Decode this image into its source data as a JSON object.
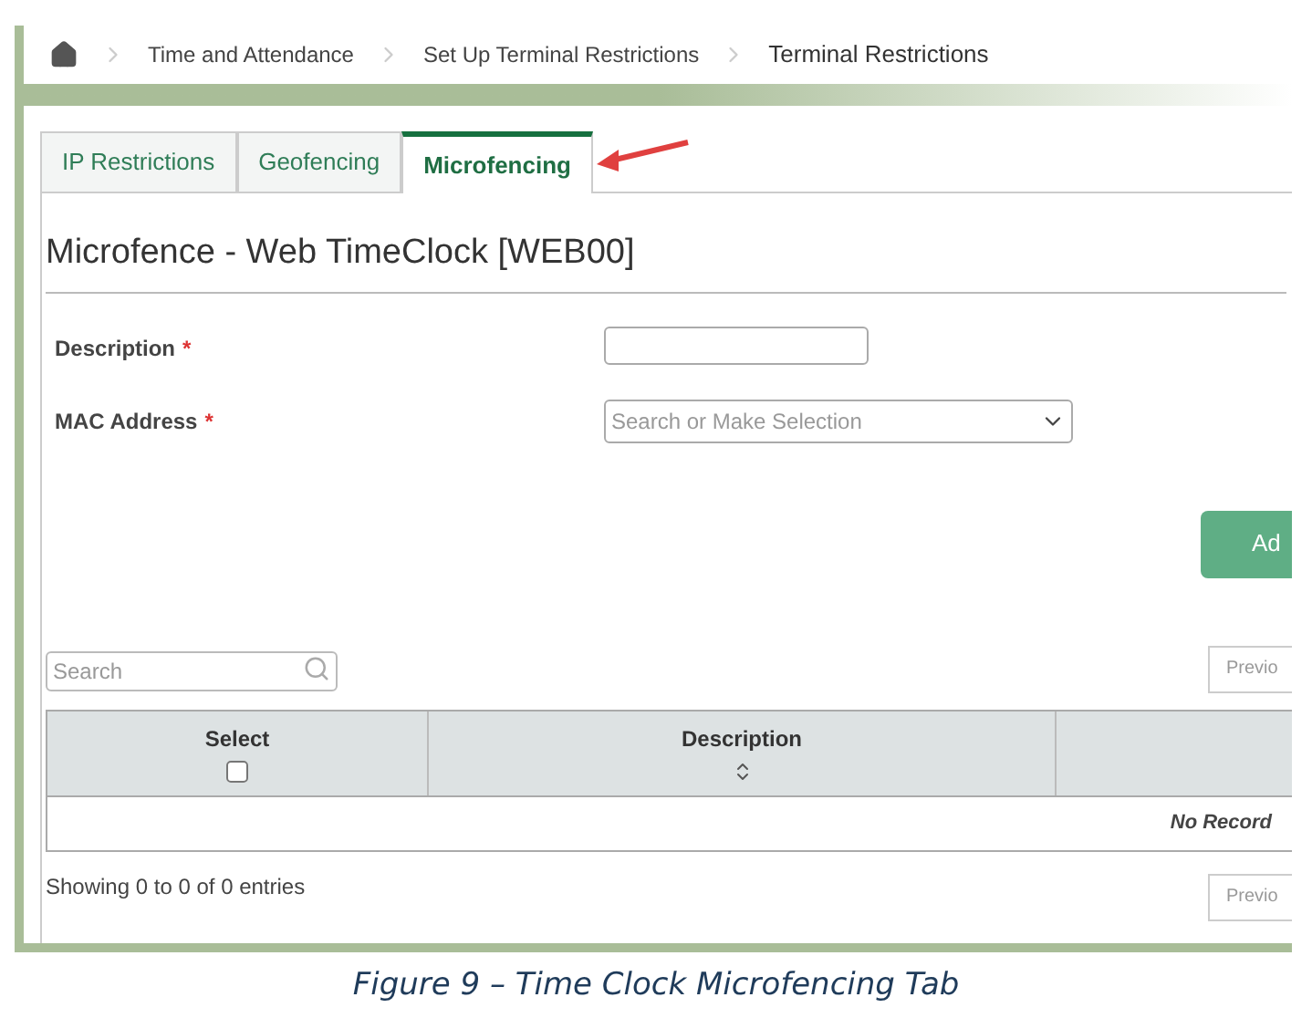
{
  "breadcrumb": [
    "Time and Attendance",
    "Set Up Terminal Restrictions",
    "Terminal Restrictions"
  ],
  "tabs": [
    {
      "label": "IP Restrictions",
      "selected": false
    },
    {
      "label": "Geofencing",
      "selected": false
    },
    {
      "label": "Microfencing",
      "selected": true
    }
  ],
  "title": "Microfence - Web TimeClock [WEB00]",
  "form": [
    {
      "kind": "text",
      "label": "Description",
      "marker": "*"
    },
    {
      "kind": "select",
      "label": "MAC Address",
      "marker": "*",
      "placeholder": "Search or Make Selection"
    }
  ],
  "add_button": "Ad",
  "search": {
    "placeholder": "Search"
  },
  "pager_top": "Previo",
  "table": {
    "columns": [
      {
        "label": "Select",
        "kind": "checkbox",
        "checked": false
      },
      {
        "label": "Description",
        "kind": "sort"
      },
      {
        "kind": "blank"
      }
    ],
    "empty": "No Record"
  },
  "footer": "Showing 0 to 0 of 0 entries",
  "pager_bottom": "Previo",
  "caption": "Figure 9 – Time Clock Microfencing Tab"
}
